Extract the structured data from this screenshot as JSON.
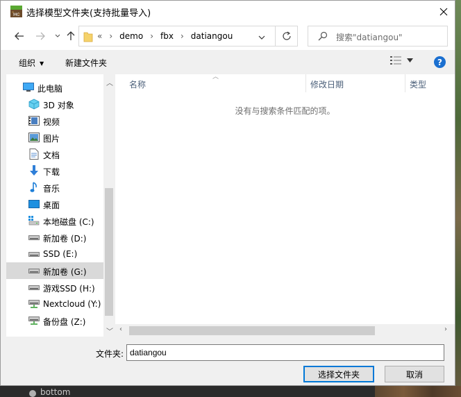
{
  "window": {
    "title": "选择模型文件夹(支持批量导入)"
  },
  "nav": {
    "breadcrumbs": [
      "demo",
      "fbx",
      "datiangou"
    ],
    "overflow_marker": "«",
    "search_placeholder": "搜索\"datiangou\""
  },
  "toolbar": {
    "organize": "组织",
    "new_folder": "新建文件夹"
  },
  "sidebar": {
    "root": "此电脑",
    "items": [
      {
        "label": "3D 对象",
        "icon": "cube-icon"
      },
      {
        "label": "视频",
        "icon": "video-icon"
      },
      {
        "label": "图片",
        "icon": "picture-icon"
      },
      {
        "label": "文档",
        "icon": "document-icon"
      },
      {
        "label": "下载",
        "icon": "download-icon"
      },
      {
        "label": "音乐",
        "icon": "music-icon"
      },
      {
        "label": "桌面",
        "icon": "desktop-icon"
      },
      {
        "label": "本地磁盘 (C:)",
        "icon": "drive-windows-icon"
      },
      {
        "label": "新加卷 (D:)",
        "icon": "drive-icon"
      },
      {
        "label": "SSD (E:)",
        "icon": "drive-icon"
      },
      {
        "label": "新加卷 (G:)",
        "icon": "drive-icon",
        "selected": true
      },
      {
        "label": "游戏SSD (H:)",
        "icon": "drive-icon"
      },
      {
        "label": "Nextcloud (Y:)",
        "icon": "network-drive-icon"
      },
      {
        "label": "备份盘 (Z:)",
        "icon": "network-drive-icon"
      }
    ]
  },
  "filelist": {
    "columns": [
      "名称",
      "修改日期",
      "类型"
    ],
    "empty_message": "没有与搜索条件匹配的项。"
  },
  "footer": {
    "folder_label": "文件夹:",
    "folder_value": "datiangou",
    "select_button": "选择文件夹",
    "cancel_button": "取消"
  },
  "background": {
    "partial_text": "bottom"
  }
}
